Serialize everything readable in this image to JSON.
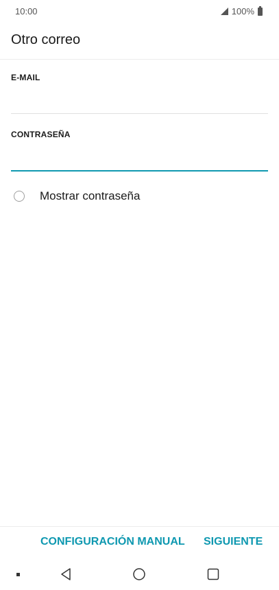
{
  "status_bar": {
    "time": "10:00",
    "battery": "100%"
  },
  "header": {
    "title": "Otro correo"
  },
  "form": {
    "email_label": "E-MAIL",
    "email_value": "",
    "password_label": "CONTRASEÑA",
    "password_value": "",
    "show_password_label": "Mostrar contraseña",
    "show_password_checked": false
  },
  "actions": {
    "manual_label": "CONFIGURACIÓN MANUAL",
    "next_label": "SIGUIENTE"
  },
  "nav": {
    "icons": [
      "recents-dot-icon",
      "back-icon",
      "home-icon",
      "overview-icon"
    ]
  },
  "colors": {
    "accent": "#0e98b0",
    "divider": "#e0e0e0",
    "text": "#1a1a1a"
  }
}
